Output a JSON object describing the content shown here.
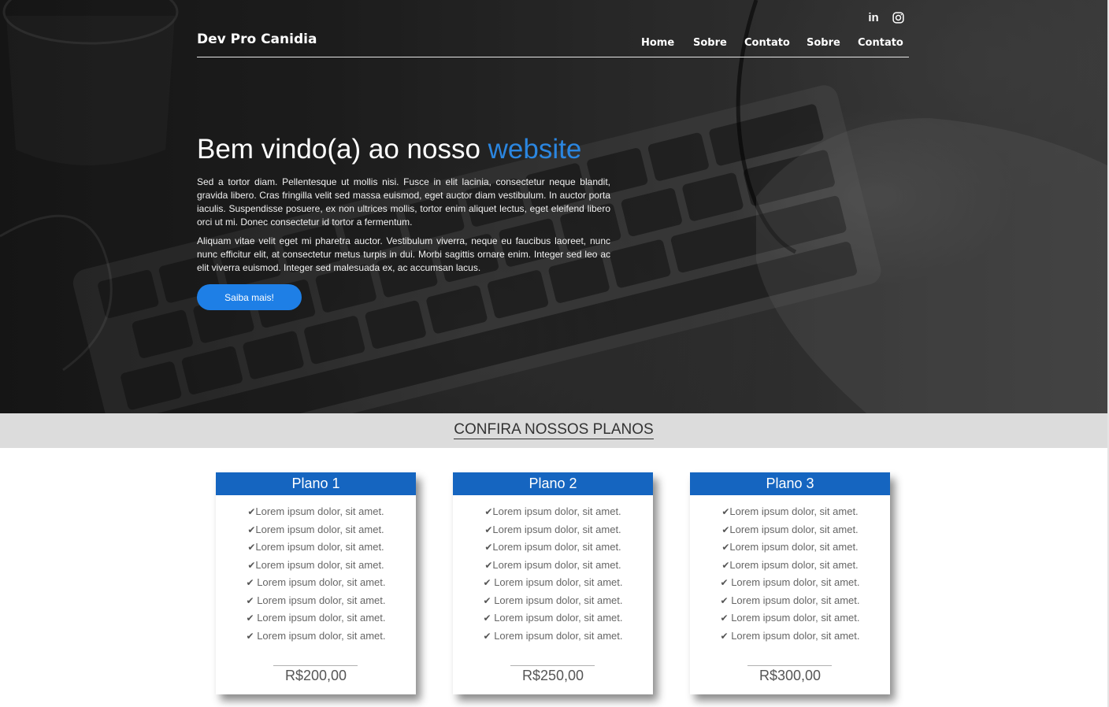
{
  "header": {
    "brand": "Dev Pro Canidia",
    "nav": [
      "Home",
      "Sobre",
      "Contato",
      "Sobre",
      "Contato"
    ],
    "social": [
      {
        "icon": "linkedin-icon",
        "label": "in"
      },
      {
        "icon": "instagram-icon"
      }
    ]
  },
  "hero": {
    "title_main": "Bem vindo(a) ao nosso ",
    "title_accent": "website",
    "paragraph1": "Sed a tortor diam. Pellentesque ut mollis nisi. Fusce in elit lacinia, consectetur neque blandit, gravida libero. Cras fringilla velit sed massa euismod, eget auctor diam vestibulum. In auctor porta iaculis. Suspendisse posuere, ex non ultrices mollis, tortor enim aliquet lectus, eget eleifend libero orci ut mi. Donec consectetur id tortor a fermentum.",
    "paragraph2": "Aliquam vitae velit eget mi pharetra auctor. Vestibulum viverra, neque eu faucibus laoreet, nunc nunc efficitur elit, at consectetur metus turpis in dui. Morbi sagittis ornare enim. Integer sed leo ac elit viverra euismod. Integer sed malesuada ex, ac accumsan lacus.",
    "cta": "Saiba mais!"
  },
  "plans_section": {
    "title": "CONFIRA NOSSOS PLANOS",
    "plans": [
      {
        "name": "Plano 1",
        "features": [
          "Lorem ipsum dolor, sit amet.",
          "Lorem ipsum dolor, sit amet.",
          "Lorem ipsum dolor, sit amet.",
          "Lorem ipsum dolor, sit amet.",
          " Lorem ipsum dolor, sit amet.",
          " Lorem ipsum dolor, sit amet.",
          " Lorem ipsum dolor, sit amet.",
          " Lorem ipsum dolor, sit amet."
        ],
        "price": "R$200,00"
      },
      {
        "name": "Plano 2",
        "features": [
          "Lorem ipsum dolor, sit amet.",
          "Lorem ipsum dolor, sit amet.",
          "Lorem ipsum dolor, sit amet.",
          "Lorem ipsum dolor, sit amet.",
          " Lorem ipsum dolor, sit amet.",
          " Lorem ipsum dolor, sit amet.",
          " Lorem ipsum dolor, sit amet.",
          " Lorem ipsum dolor, sit amet."
        ],
        "price": "R$250,00"
      },
      {
        "name": "Plano 3",
        "features": [
          "Lorem ipsum dolor, sit amet.",
          "Lorem ipsum dolor, sit amet.",
          "Lorem ipsum dolor, sit amet.",
          "Lorem ipsum dolor, sit amet.",
          " Lorem ipsum dolor, sit amet.",
          " Lorem ipsum dolor, sit amet.",
          " Lorem ipsum dolor, sit amet.",
          " Lorem ipsum dolor, sit amet."
        ],
        "price": "R$300,00"
      }
    ]
  },
  "colors": {
    "accent": "#2b86e0",
    "button": "#1e7fe6",
    "card_header": "#1565c0",
    "band": "#dcdcdc"
  }
}
